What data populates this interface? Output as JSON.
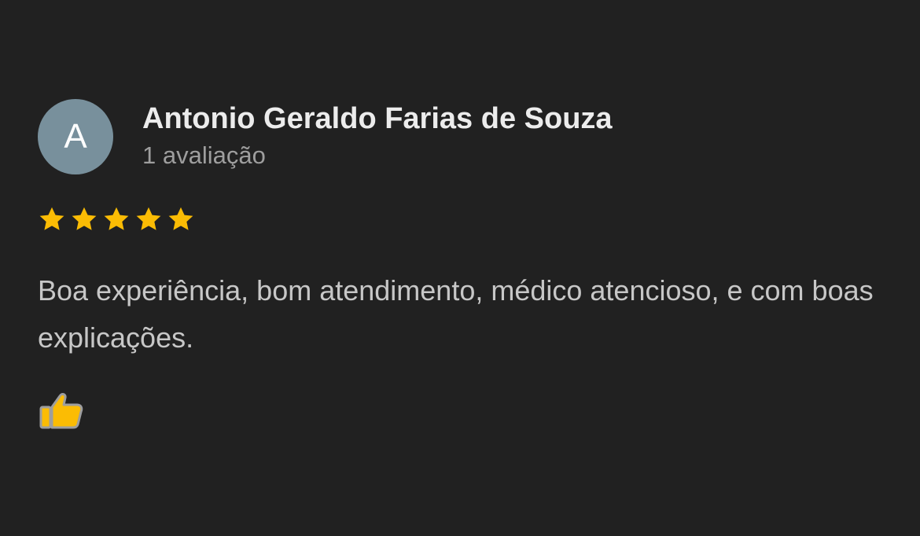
{
  "review": {
    "avatar_letter": "A",
    "author_name": "Antonio Geraldo Farias de Souza",
    "author_review_count": "1 avaliação",
    "rating": 5,
    "rating_max": 5,
    "text": "Boa experiência, bom atendimento, médico atencioso, e com boas explicações.",
    "like_icon": "thumbs-up-icon"
  },
  "colors": {
    "background": "#212121",
    "avatar": "#78909c",
    "star": "#fbbc04",
    "like_fill": "#fbbc04",
    "like_outline": "#9e9e9e"
  }
}
